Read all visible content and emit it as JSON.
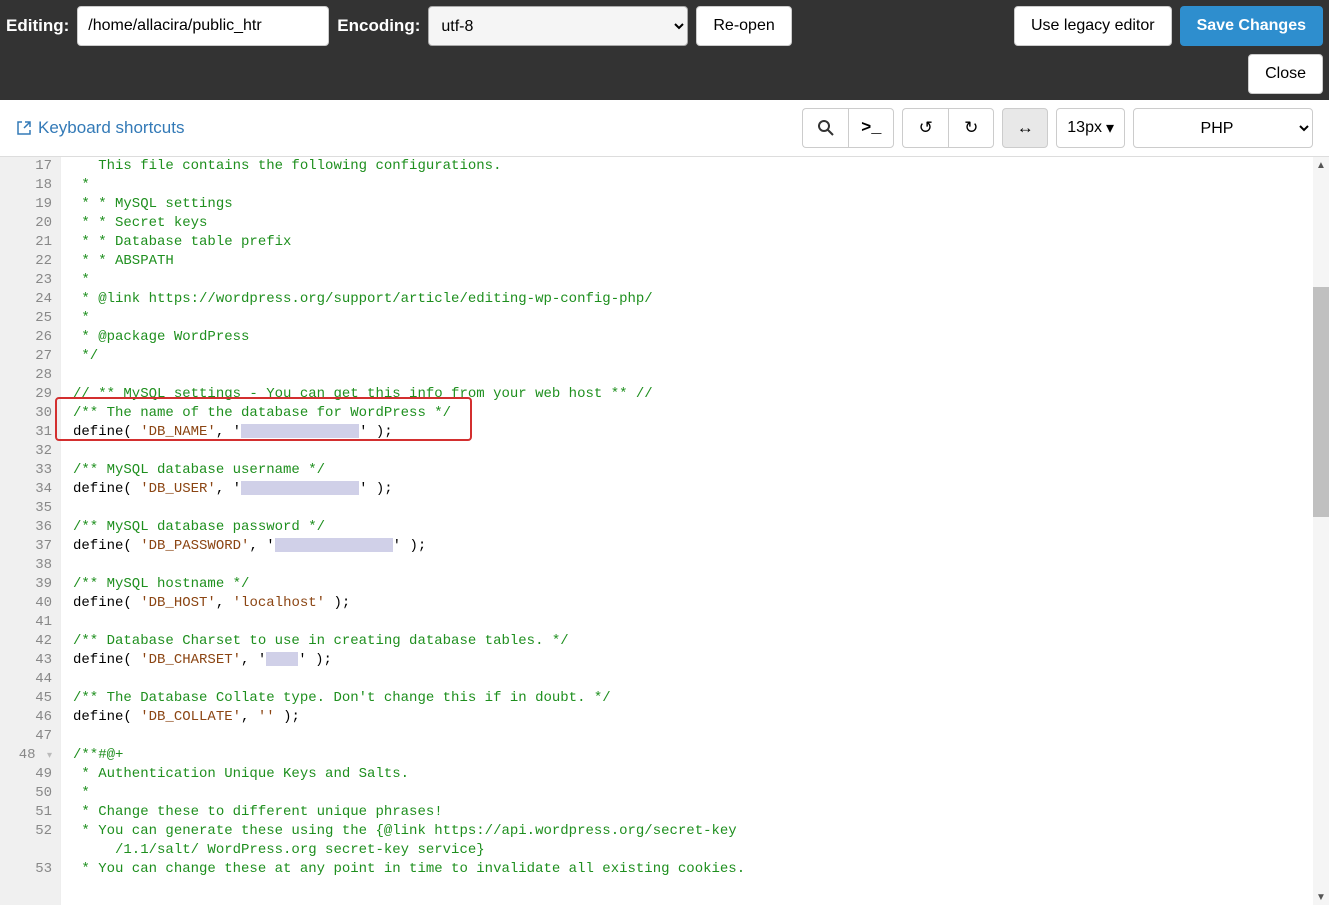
{
  "header": {
    "editing_label": "Editing:",
    "path": "/home/allacira/public_htr",
    "encoding_label": "Encoding:",
    "encoding_value": "utf-8",
    "reopen": "Re-open",
    "legacy": "Use legacy editor",
    "save": "Save Changes",
    "close": "Close"
  },
  "toolbar": {
    "kb_shortcuts": "Keyboard shortcuts",
    "font_size": "13px",
    "language": "PHP"
  },
  "lines": {
    "17": {
      "text": "   This file contains the following configurations.",
      "cls": "comment"
    },
    "18": {
      "text": " *",
      "cls": "comment"
    },
    "19": {
      "text": " * * MySQL settings",
      "cls": "comment"
    },
    "20": {
      "text": " * * Secret keys",
      "cls": "comment"
    },
    "21": {
      "text": " * * Database table prefix",
      "cls": "comment"
    },
    "22": {
      "text": " * * ABSPATH",
      "cls": "comment"
    },
    "23": {
      "text": " *",
      "cls": "comment"
    },
    "24": {
      "text": " * @link https://wordpress.org/support/article/editing-wp-config-php/",
      "cls": "comment"
    },
    "25": {
      "text": " *",
      "cls": "comment"
    },
    "26": {
      "text": " * @package WordPress",
      "cls": "comment"
    },
    "27": {
      "text": " */",
      "cls": "comment"
    },
    "28": {
      "text": "",
      "cls": ""
    },
    "29": {
      "text": "// ** MySQL settings - You can get this info from your web host ** //",
      "cls": "comment"
    },
    "30": {
      "text": "/** The name of the database for WordPress */",
      "cls": "comment"
    },
    "31_a": "define( ",
    "31_b": "'DB_NAME'",
    "31_c": ", '",
    "31_d": "' );",
    "32": {
      "text": "",
      "cls": ""
    },
    "33": {
      "text": "/** MySQL database username */",
      "cls": "comment"
    },
    "34_a": "define( ",
    "34_b": "'DB_USER'",
    "34_c": ", '",
    "34_d": "' );",
    "35": {
      "text": "",
      "cls": ""
    },
    "36": {
      "text": "/** MySQL database password */",
      "cls": "comment"
    },
    "37_a": "define( ",
    "37_b": "'DB_PASSWORD'",
    "37_c": ", '",
    "37_d": "' );",
    "38": {
      "text": "",
      "cls": ""
    },
    "39": {
      "text": "/** MySQL hostname */",
      "cls": "comment"
    },
    "40_a": "define( ",
    "40_b": "'DB_HOST'",
    "40_c": ", ",
    "40_d": "'localhost'",
    "40_e": " );",
    "41": {
      "text": "",
      "cls": ""
    },
    "42": {
      "text": "/** Database Charset to use in creating database tables. */",
      "cls": "comment"
    },
    "43_a": "define( ",
    "43_b": "'DB_CHARSET'",
    "43_c": ", '",
    "43_d": "' );",
    "44": {
      "text": "",
      "cls": ""
    },
    "45": {
      "text": "/** The Database Collate type. Don't change this if in doubt. */",
      "cls": "comment"
    },
    "46_a": "define( ",
    "46_b": "'DB_COLLATE'",
    "46_c": ", ",
    "46_d": "''",
    "46_e": " );",
    "47": {
      "text": "",
      "cls": ""
    },
    "48": {
      "text": "/**#@+",
      "cls": "comment"
    },
    "49": {
      "text": " * Authentication Unique Keys and Salts.",
      "cls": "comment"
    },
    "50": {
      "text": " *",
      "cls": "comment"
    },
    "51": {
      "text": " * Change these to different unique phrases!",
      "cls": "comment"
    },
    "52": {
      "text": " * You can generate these using the {@link https://api.wordpress.org/secret-key",
      "cls": "comment"
    },
    "52b": {
      "text": "     /1.1/salt/ WordPress.org secret-key service}",
      "cls": "comment"
    },
    "53": {
      "text": " * You can change these at any point in time to invalidate all existing cookies.",
      "cls": "comment"
    }
  }
}
